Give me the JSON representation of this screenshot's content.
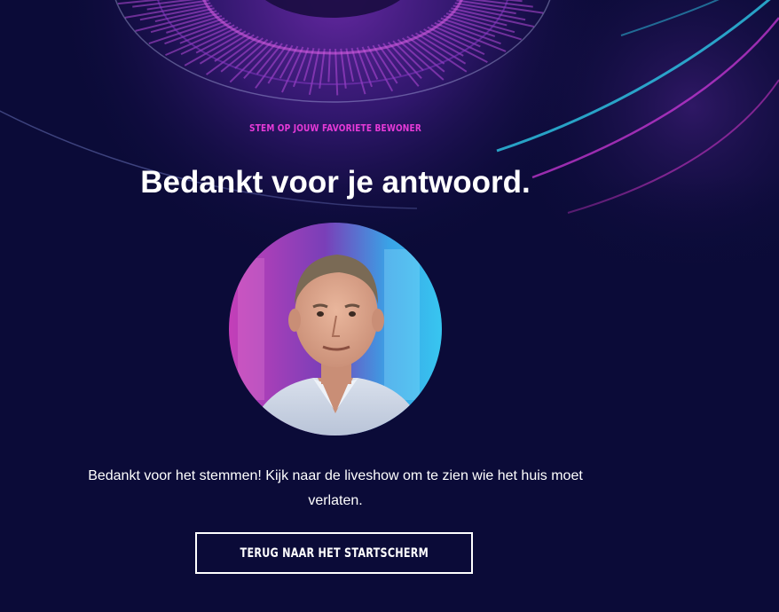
{
  "hero": {
    "kicker": "STEM OP JOUW FAVORIETE BEWONER",
    "title": "Bedankt voor je antwoord."
  },
  "result": {
    "avatar_icon": "contestant-portrait",
    "message": "Bedankt voor het stemmen! Kijk naar de liveshow om te zien wie het huis moet verlaten."
  },
  "actions": {
    "back_label": "TERUG NAAR HET STARTSCHERM"
  },
  "colors": {
    "background": "#0b0b38",
    "accent_pink": "#e63ad8",
    "accent_cyan": "#2ec8e8",
    "text": "#ffffff"
  }
}
